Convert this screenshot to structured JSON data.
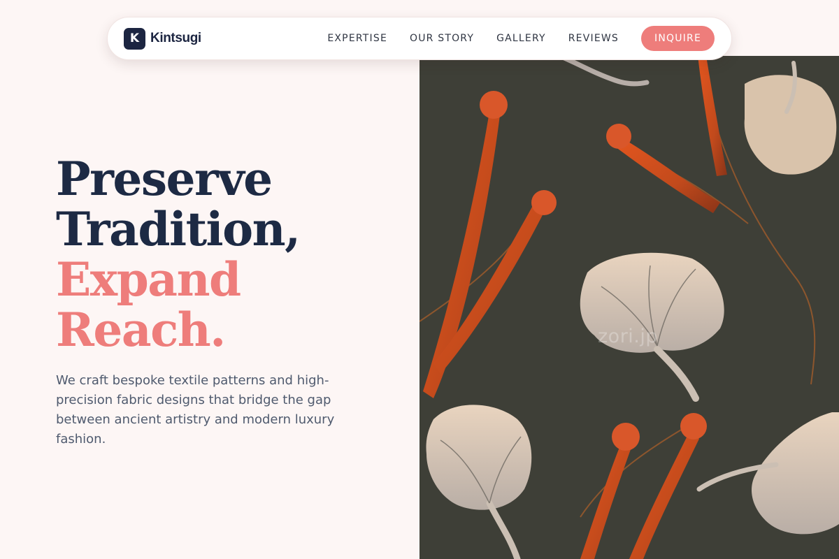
{
  "brand": {
    "logo_letter": "K",
    "name": "Kintsugi"
  },
  "nav": {
    "links": [
      "EXPERTISE",
      "OUR STORY",
      "GALLERY",
      "REVIEWS"
    ],
    "cta_label": "INQUIRE"
  },
  "hero": {
    "title_lines": [
      "Preserve",
      "Tradition,",
      "Expand",
      "Reach."
    ],
    "body": "We craft bespoke textile patterns and high-precision fabric designs that bridge the gap between ancient artistry and modern luxury fashion.",
    "image_watermark": "zori.jp"
  },
  "colors": {
    "background": "#fdf6f5",
    "navy": "#1d2a44",
    "accent": "#ee7d7b",
    "fabric": "#3e3f37"
  }
}
